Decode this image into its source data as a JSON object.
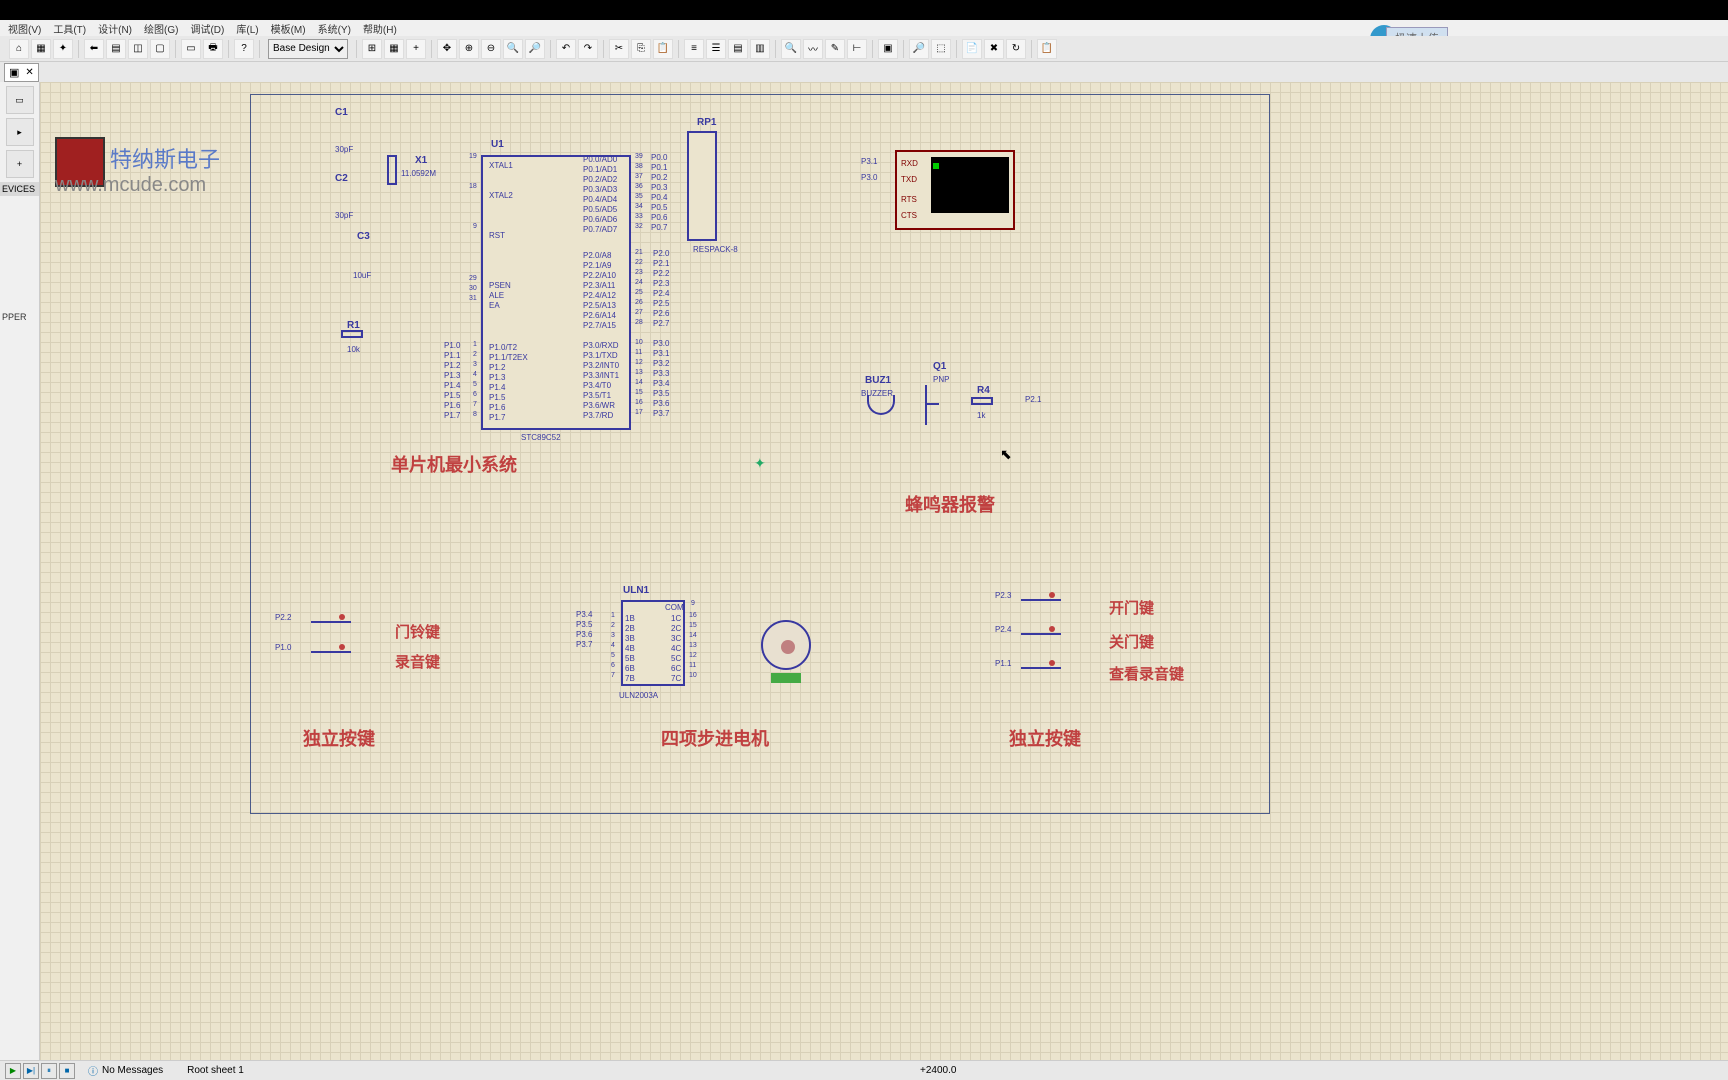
{
  "menubar": {
    "items": [
      "视图(V)",
      "工具(T)",
      "设计(N)",
      "绘图(G)",
      "调试(D)",
      "库(L)",
      "模板(M)",
      "系统(Y)",
      "帮助(H)"
    ]
  },
  "toolbar": {
    "combo": "Base Design"
  },
  "cloud": {
    "upload": "极速上传"
  },
  "tabs": {
    "close": "✕"
  },
  "sidebar": {
    "devices": "EVICES",
    "item1": "PPER"
  },
  "watermark": {
    "brand": "特纳斯电子",
    "url": "www.mcude.com"
  },
  "chip": {
    "u1": "U1",
    "model": "STC89C52",
    "x1": "X1",
    "x1val": "11.0592M",
    "xtal1": "XTAL1",
    "xtal2": "XTAL2",
    "rst": "RST",
    "psen": "PSEN",
    "ale": "ALE",
    "ea": "EA",
    "c1": "C1",
    "c1val": "30pF",
    "c2": "C2",
    "c2val": "30pF",
    "c3": "C3",
    "c3val": "10uF",
    "r1": "R1",
    "r1val": "10k",
    "rp1": "RP1",
    "respack": "RESPACK-8"
  },
  "pins": {
    "p00": "P0.0/AD0",
    "p01": "P0.1/AD1",
    "p02": "P0.2/AD2",
    "p03": "P0.3/AD3",
    "p04": "P0.4/AD4",
    "p05": "P0.5/AD5",
    "p06": "P0.6/AD6",
    "p07": "P0.7/AD7",
    "p20": "P2.0/A8",
    "p21": "P2.1/A9",
    "p22": "P2.2/A10",
    "p23": "P2.3/A11",
    "p24": "P2.4/A12",
    "p25": "P2.5/A13",
    "p26": "P2.6/A14",
    "p27": "P2.7/A15",
    "p30": "P3.0/RXD",
    "p31": "P3.1/TXD",
    "p32": "P3.2/INT0",
    "p33": "P3.3/INT1",
    "p34": "P3.4/T0",
    "p35": "P3.5/T1",
    "p36": "P3.6/WR",
    "p37": "P3.7/RD",
    "p10": "P1.0/T2",
    "p11": "P1.1/T2EX",
    "p12": "P1.2",
    "p13": "P1.3",
    "p14": "P1.4",
    "p15": "P1.5",
    "p16": "P1.6",
    "p17": "P1.7"
  },
  "sections": {
    "mcu": "单片机最小系统",
    "buzzer": "蜂鸣器报警",
    "keys1": "独立按键",
    "keys2": "独立按键",
    "stepper": "四项步进电机"
  },
  "buzzer": {
    "buz1": "BUZ1",
    "buzzer": "BUZZER",
    "q1": "Q1",
    "pnp": "PNP",
    "r4": "R4",
    "r4val": "1k",
    "p21": "P2.1"
  },
  "terminal": {
    "rxd": "RXD",
    "txd": "TXD",
    "rts": "RTS",
    "cts": "CTS",
    "p31": "P3.1",
    "p30": "P3.0"
  },
  "uln": {
    "name": "ULN1",
    "model": "ULN2003A",
    "com": "COM",
    "b1": "1B",
    "b2": "2B",
    "b3": "3B",
    "b4": "4B",
    "b5": "5B",
    "b6": "6B",
    "b7": "7B",
    "c1": "1C",
    "c2": "2C",
    "c3": "3C",
    "c4": "4C",
    "c5": "5C",
    "c6": "6C",
    "c7": "7C",
    "p34": "P3.4",
    "p35": "P3.5",
    "p36": "P3.6",
    "p37": "P3.7"
  },
  "keys": {
    "p22": "P2.2",
    "p10": "P1.0",
    "doorbell": "门铃键",
    "record": "录音键",
    "p23": "P2.3",
    "p24": "P2.4",
    "p11": "P1.1",
    "open": "开门键",
    "close": "关门键",
    "view": "查看录音键"
  },
  "rpins": {
    "p00": "P0.0",
    "p01": "P0.1",
    "p02": "P0.2",
    "p03": "P0.3",
    "p04": "P0.4",
    "p05": "P0.5",
    "p06": "P0.6",
    "p07": "P0.7",
    "p20": "P2.0",
    "p21": "P2.1",
    "p22": "P2.2",
    "p23": "P2.3",
    "p24": "P2.4",
    "p25": "P2.5",
    "p26": "P2.6",
    "p27": "P2.7",
    "p30": "P3.0",
    "p31": "P3.1",
    "p32": "P3.2",
    "p33": "P3.3",
    "p34": "P3.4",
    "p35": "P3.5",
    "p36": "P3.6",
    "p37": "P3.7",
    "p10": "P1.0",
    "p11": "P1.1",
    "p12": "P1.2",
    "p13": "P1.3",
    "p14": "P1.4",
    "p15": "P1.5",
    "p16": "P1.6",
    "p17": "P1.7"
  },
  "pinNums": {
    "n39": "39",
    "n38": "38",
    "n37": "37",
    "n36": "36",
    "n35": "35",
    "n34": "34",
    "n33": "33",
    "n32": "32",
    "n21": "21",
    "n22": "22",
    "n23": "23",
    "n24": "24",
    "n25": "25",
    "n26": "26",
    "n27": "27",
    "n28": "28",
    "n10": "10",
    "n11": "11",
    "n12": "12",
    "n13": "13",
    "n14": "14",
    "n15": "15",
    "n16": "16",
    "n17": "17",
    "n19": "19",
    "n18": "18",
    "n9": "9",
    "n29": "29",
    "n30": "30",
    "n31": "31",
    "n1": "1",
    "n2": "2",
    "n3": "3",
    "n4": "4",
    "n5": "5",
    "n6": "6",
    "n7": "7",
    "n8": "8",
    "u16": "16",
    "u15": "15",
    "u14": "14",
    "u13": "13",
    "u12": "12",
    "u11": "11",
    "u10": "10",
    "u9": "9"
  },
  "status": {
    "msg": "No Messages",
    "sheet": "Root sheet 1",
    "coord": "+2400.0"
  }
}
